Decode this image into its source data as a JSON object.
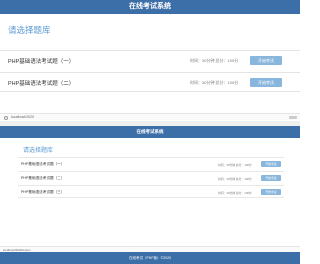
{
  "header": {
    "title": "在线考试系统"
  },
  "top_view": {
    "section_title": "请选择题库",
    "exams": [
      {
        "name": "PHP基础语法考试题（一）",
        "meta": "时间：30分钟  总分：100分",
        "button": "开始考试"
      },
      {
        "name": "PHP基础语法考试题（二）",
        "meta": "时间：30分钟  总分：100分",
        "button": "开始考试"
      }
    ],
    "status_url": "localhost/2020"
  },
  "bottom_view": {
    "header_title": "在线考试系统",
    "section_title": "请选择题库",
    "exams": [
      {
        "name": "PHP基础语法考试题（一）",
        "meta": "时间：30分钟  总分：100分",
        "button": "开始考试"
      },
      {
        "name": "PHP基础语法考试题（二）",
        "meta": "时间：30分钟  总分：100分",
        "button": "开始考试"
      },
      {
        "name": "PHP基础语法考试题（三）",
        "meta": "时间：30分钟  总分：100分",
        "button": "开始考试"
      }
    ],
    "status_url": "localhost/2020/exam",
    "footer_text": "在线考试（PHP版）©2020"
  },
  "colors": {
    "brand": "#3c6ea8",
    "accent": "#5a9bd4",
    "button": "#89b6dc"
  }
}
